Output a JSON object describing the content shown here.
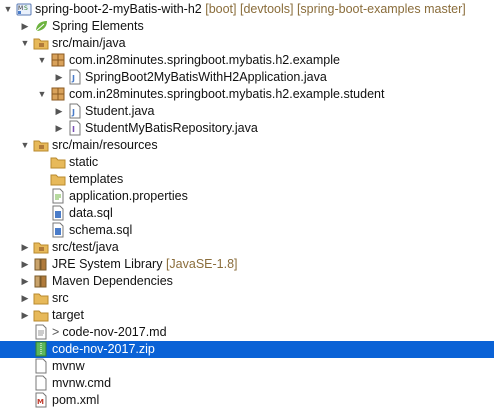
{
  "explorer": {
    "project": {
      "name": "spring-boot-2-myBatis-with-h2",
      "decoration": "[boot] [devtools] [spring-boot-examples master]"
    },
    "items": [
      {
        "label": "Spring Elements"
      },
      {
        "label": "src/main/java"
      },
      {
        "label": "com.in28minutes.springboot.mybatis.h2.example"
      },
      {
        "label": "SpringBoot2MyBatisWithH2Application.java"
      },
      {
        "label": "com.in28minutes.springboot.mybatis.h2.example.student"
      },
      {
        "label": "Student.java"
      },
      {
        "label": "StudentMyBatisRepository.java"
      },
      {
        "label": "src/main/resources"
      },
      {
        "label": "static"
      },
      {
        "label": "templates"
      },
      {
        "label": "application.properties"
      },
      {
        "label": "data.sql"
      },
      {
        "label": "schema.sql"
      },
      {
        "label": "src/test/java"
      },
      {
        "label": "JRE System Library",
        "decoration": "[JavaSE-1.8]"
      },
      {
        "label": "Maven Dependencies"
      },
      {
        "label": "src"
      },
      {
        "label": "target"
      },
      {
        "label": "code-nov-2017.md",
        "prefix": ">"
      },
      {
        "label": "code-nov-2017.zip",
        "selected": true
      },
      {
        "label": "mvnw"
      },
      {
        "label": "mvnw.cmd"
      },
      {
        "label": "pom.xml"
      }
    ]
  },
  "colors": {
    "selection": "#0a62d6",
    "folder": "#e7b95a",
    "package": "#b07a3a",
    "java": "#4a7cc9",
    "decoration": "#8a6d3b"
  }
}
